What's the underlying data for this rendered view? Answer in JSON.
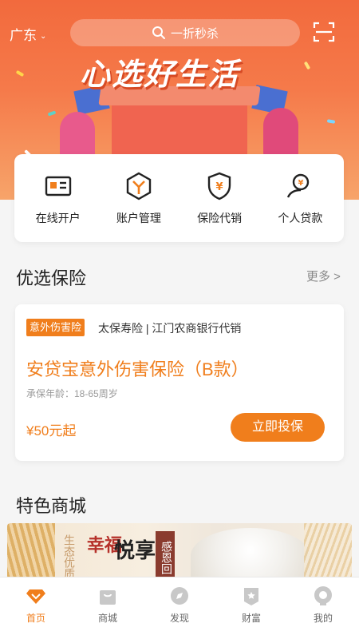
{
  "header": {
    "region": "广东",
    "search_placeholder": "一折秒杀",
    "banner_headline": "心选好生活"
  },
  "quick_actions": [
    {
      "label": "在线开户",
      "icon": "id-card-icon"
    },
    {
      "label": "账户管理",
      "icon": "hexagon-y-icon"
    },
    {
      "label": "保险代销",
      "icon": "shield-yen-icon"
    },
    {
      "label": "个人贷款",
      "icon": "person-yen-icon"
    }
  ],
  "featured_insurance": {
    "section_title": "优选保险",
    "more_label": "更多 >",
    "badge": "意外伤害险",
    "provider": "太保寿险 | 江门农商银行代销",
    "product_name": "安贷宝意外伤害保险（B款）",
    "age_range": "承保年龄：18-65周岁",
    "price": "¥50元起",
    "buy_button": "立即投保"
  },
  "mall": {
    "section_title": "特色商城",
    "banner_text_1": "生态优质",
    "banner_text_2": "幸福",
    "banner_text_3": "悦享",
    "banner_tag": "感恩回"
  },
  "tabbar": [
    {
      "label": "首页",
      "icon": "home-diamond-icon",
      "active": true
    },
    {
      "label": "商城",
      "icon": "shopping-bag-icon",
      "active": false
    },
    {
      "label": "发现",
      "icon": "compass-icon",
      "active": false
    },
    {
      "label": "财富",
      "icon": "wealth-star-icon",
      "active": false
    },
    {
      "label": "我的",
      "icon": "user-profile-icon",
      "active": false
    }
  ],
  "colors": {
    "accent": "#f07e1c",
    "banner_top": "#f26a3d",
    "text_primary": "#222222",
    "text_muted": "#999999"
  }
}
